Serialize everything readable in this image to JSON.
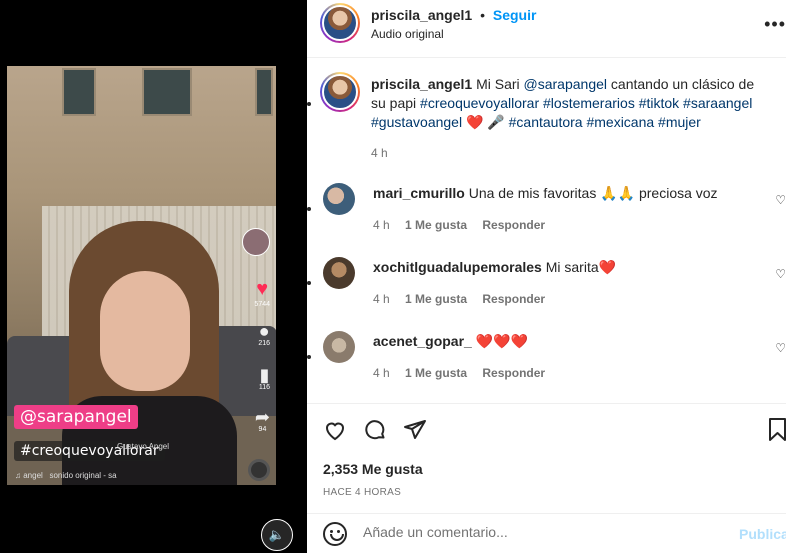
{
  "post": {
    "username": "priscila_angel1",
    "follow_label": "Seguir",
    "audio_label": "Audio original",
    "more_icon": "more-options-icon",
    "caption": {
      "username": "priscila_angel1",
      "text_1": "Mi Sari",
      "mention": "@sarapangel",
      "text_2": "cantando un clásico de su papi",
      "tags_1": "#creoquevoyallorar #lostemerarios #tiktok #saraangel",
      "tags_2": "#gustavoangel",
      "emoji": "❤️ 🎤",
      "tags_3": "#cantautora #mexicana #mujer",
      "time": "4 h"
    },
    "likes": "2,353 Me gusta",
    "posted": "HACE 4 HORAS"
  },
  "comments": [
    {
      "username": "mari_cmurillo",
      "text": "Una de mis favoritas 🙏🙏  preciosa voz",
      "time": "4 h",
      "likes": "1 Me gusta",
      "reply": "Responder"
    },
    {
      "username": "xochitlguadalupemorales",
      "text": "Mi sarita❤️",
      "time": "4 h",
      "likes": "1 Me gusta",
      "reply": "Responder"
    },
    {
      "username": "acenet_gopar_",
      "text": "❤️❤️❤️",
      "time": "4 h",
      "likes": "1 Me gusta",
      "reply": "Responder"
    }
  ],
  "video": {
    "tag_1": "@sarapangel",
    "tag_2": "#creoquevoyallorar",
    "credit": "Gustavo Angel",
    "sound": "sonido original - sa",
    "sound_user": "angel",
    "like_count": "5744",
    "comment_count": "216",
    "save_count": "116",
    "share_count": "94"
  },
  "add_comment": {
    "placeholder": "Añade un comentario...",
    "publish": "Publicar"
  },
  "colors": {
    "accent": "#0095f6",
    "link": "#00376b",
    "tiktok_red": "#fe2c55",
    "tag_pink": "#ee3e87"
  }
}
